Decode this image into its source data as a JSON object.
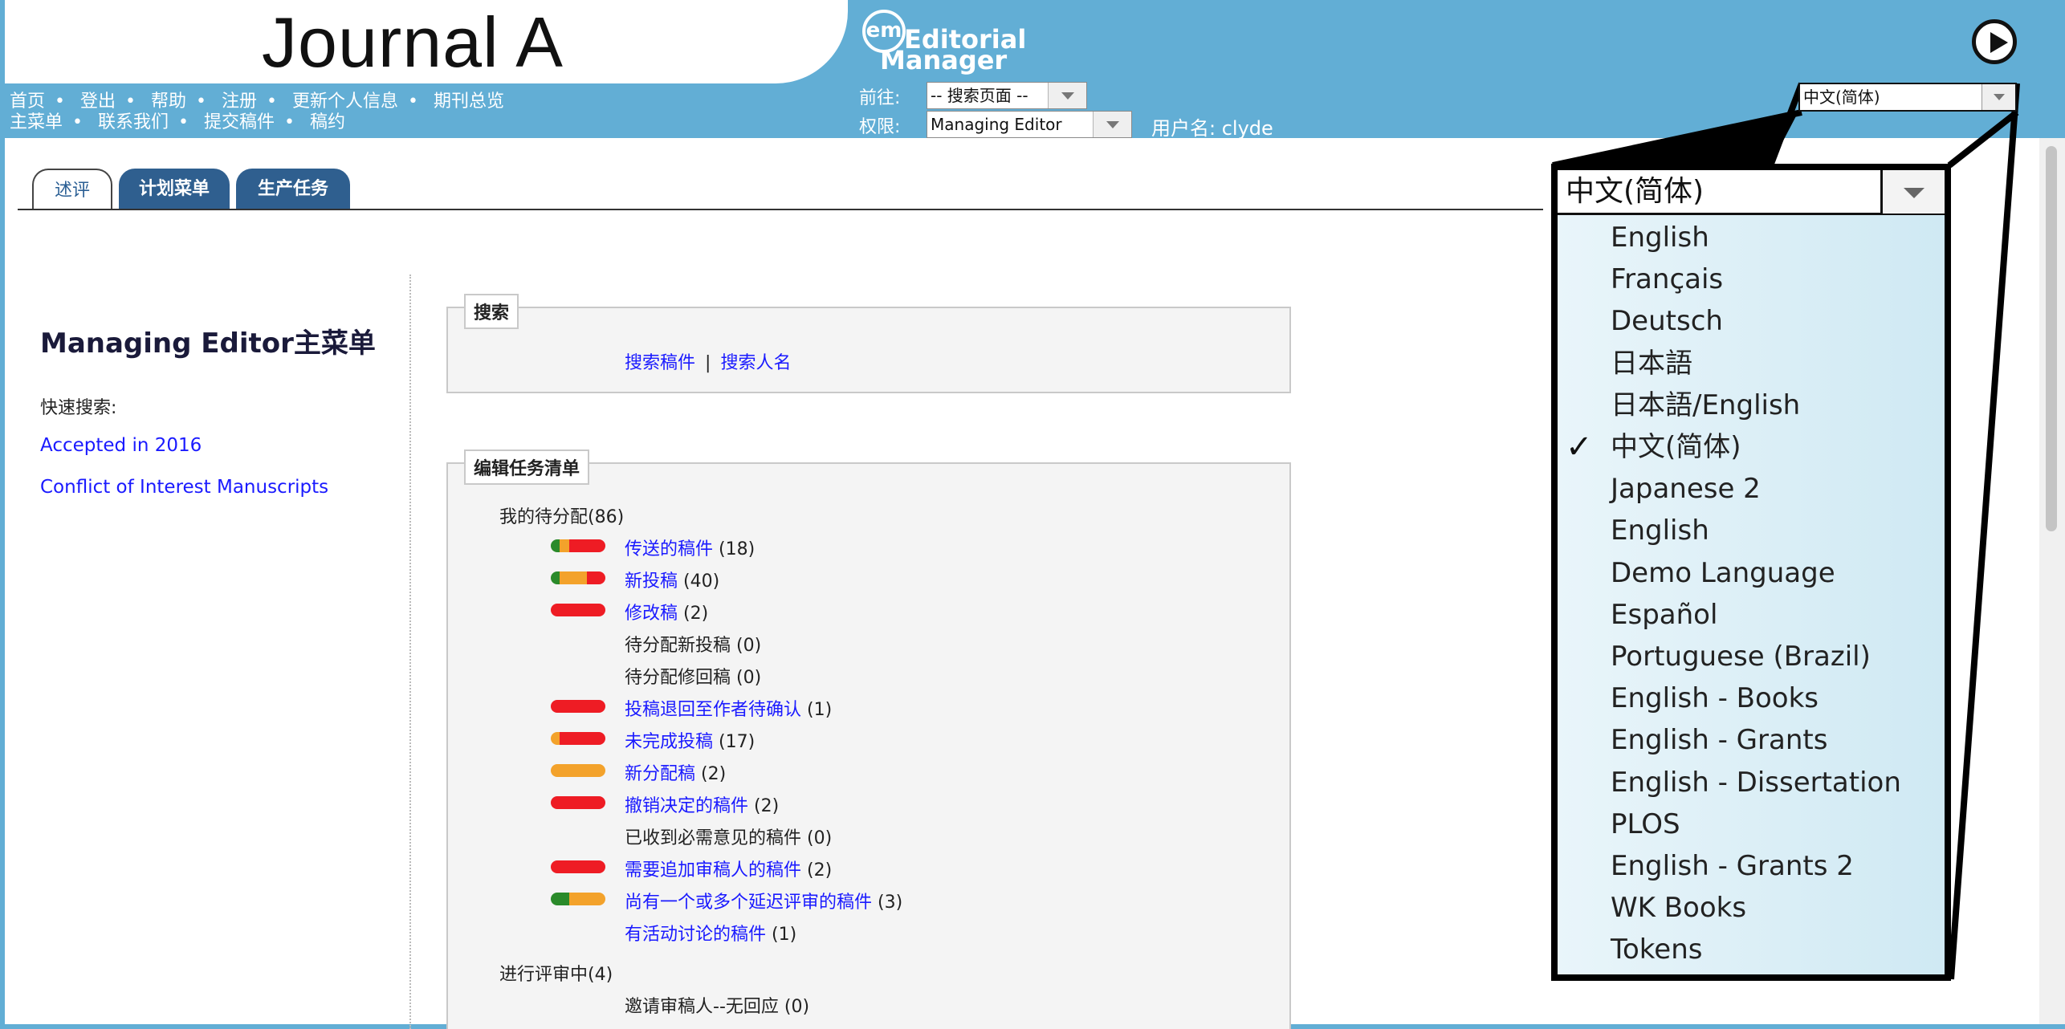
{
  "header": {
    "journal_title": "Journal A",
    "logo": {
      "em": "em",
      "word1": "Editorial",
      "word2": "Manager"
    },
    "nav_row_1": [
      "首页",
      "登出",
      "帮助",
      "注册",
      "更新个人信息",
      "期刊总览"
    ],
    "nav_row_2": [
      "主菜单",
      "联系我们",
      "提交稿件",
      "稿约"
    ],
    "goto_label": "前往:",
    "goto_value": "-- 搜索页面 --",
    "role_label": "权限:",
    "role_value": "Managing Editor",
    "username_text": "用户名: clyde",
    "language_value": "中文(简体)"
  },
  "tabs": [
    "述评",
    "计划菜单",
    "生产任务"
  ],
  "left_panel": {
    "title": "Managing Editor主菜单",
    "quick_search_label": "快速搜索:",
    "quick_links": [
      "Accepted in 2016",
      "Conflict of Interest Manuscripts"
    ]
  },
  "search_box": {
    "legend": "搜索",
    "link1": "搜索稿件",
    "separator": "|",
    "link2": "搜索人名"
  },
  "tasks_box": {
    "legend": "编辑任务清单",
    "group1": "我的待分配(86)",
    "group2": "进行评审中(4)",
    "items": [
      {
        "label": "传送的稿件",
        "count": "(18)",
        "link": true,
        "colors": [
          "#2a8a2a",
          "#f3a22b",
          "#ee1c24"
        ],
        "weights": [
          1,
          1,
          4
        ]
      },
      {
        "label": "新投稿",
        "count": "(40)",
        "link": true,
        "colors": [
          "#2a8a2a",
          "#f3a22b",
          "#ee1c24"
        ],
        "weights": [
          1,
          3,
          2
        ]
      },
      {
        "label": "修改稿",
        "count": "(2)",
        "link": true,
        "colors": [
          "#ee1c24"
        ],
        "weights": [
          1
        ]
      },
      {
        "label": "待分配新投稿",
        "count": "(0)",
        "link": false,
        "colors": [],
        "weights": []
      },
      {
        "label": "待分配修回稿",
        "count": "(0)",
        "link": false,
        "colors": [],
        "weights": []
      },
      {
        "label": "投稿退回至作者待确认",
        "count": "(1)",
        "link": true,
        "colors": [
          "#ee1c24"
        ],
        "weights": [
          1
        ]
      },
      {
        "label": "未完成投稿",
        "count": "(17)",
        "link": true,
        "colors": [
          "#f3a22b",
          "#ee1c24"
        ],
        "weights": [
          1,
          5
        ]
      },
      {
        "label": "新分配稿",
        "count": "(2)",
        "link": true,
        "colors": [
          "#f3a22b"
        ],
        "weights": [
          1
        ]
      },
      {
        "label": "撤销决定的稿件",
        "count": "(2)",
        "link": true,
        "colors": [
          "#ee1c24"
        ],
        "weights": [
          1
        ]
      },
      {
        "label": "已收到必需意见的稿件",
        "count": "(0)",
        "link": false,
        "colors": [],
        "weights": []
      },
      {
        "label": "需要追加审稿人的稿件",
        "count": "(2)",
        "link": true,
        "colors": [
          "#ee1c24"
        ],
        "weights": [
          1
        ]
      },
      {
        "label": "尚有一个或多个延迟评审的稿件",
        "count": "(3)",
        "link": true,
        "colors": [
          "#2a8a2a",
          "#f3a22b"
        ],
        "weights": [
          1,
          2
        ]
      },
      {
        "label": "有活动讨论的稿件",
        "count": "(1)",
        "link": true,
        "colors": [],
        "weights": []
      }
    ],
    "sub_items": [
      {
        "label": "邀请审稿人--无回应",
        "count": "(0)",
        "link": false
      }
    ]
  },
  "language_dropdown": {
    "selected": "中文(简体)",
    "check_mark": "✓",
    "options": [
      "English",
      "Français",
      "Deutsch",
      "日本語",
      "日本語/English",
      "中文(简体)",
      "Japanese 2",
      "English",
      "Demo Language",
      "Español",
      "Portuguese (Brazil)",
      "English - Books",
      "English - Grants",
      "English - Dissertation",
      "PLOS",
      "English - Grants 2",
      "WK Books",
      "Tokens"
    ],
    "selected_index": 5
  }
}
